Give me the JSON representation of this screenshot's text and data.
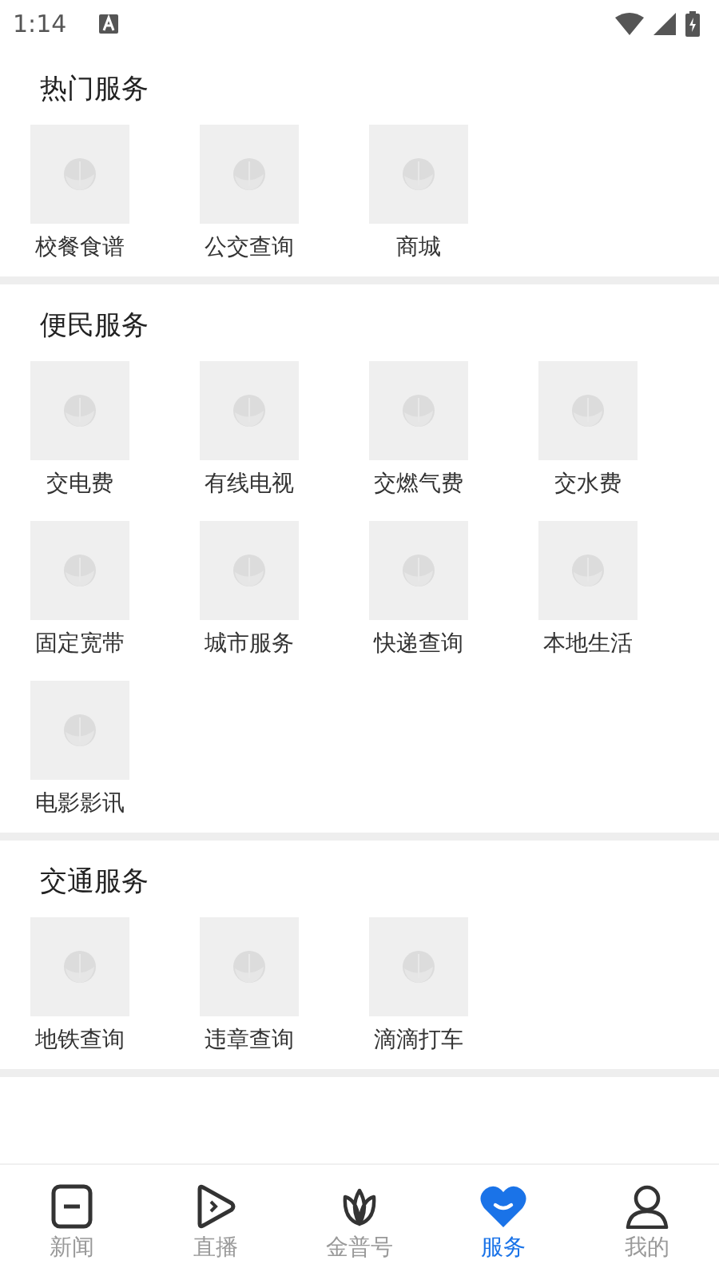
{
  "status_bar": {
    "time": "1:14"
  },
  "sections": [
    {
      "title": "热门服务",
      "items": [
        {
          "label": "校餐食谱"
        },
        {
          "label": "公交查询"
        },
        {
          "label": "商城"
        }
      ]
    },
    {
      "title": "便民服务",
      "items": [
        {
          "label": "交电费"
        },
        {
          "label": "有线电视"
        },
        {
          "label": "交燃气费"
        },
        {
          "label": "交水费"
        },
        {
          "label": "固定宽带"
        },
        {
          "label": "城市服务"
        },
        {
          "label": "快递查询"
        },
        {
          "label": "本地生活"
        },
        {
          "label": "电影影讯"
        }
      ]
    },
    {
      "title": "交通服务",
      "items": [
        {
          "label": "地铁查询"
        },
        {
          "label": "违章查询"
        },
        {
          "label": "滴滴打车"
        }
      ]
    }
  ],
  "bottom_nav": [
    {
      "label": "新闻",
      "selected": false
    },
    {
      "label": "直播",
      "selected": false
    },
    {
      "label": "金普号",
      "selected": false
    },
    {
      "label": "服务",
      "selected": true
    },
    {
      "label": "我的",
      "selected": false
    }
  ]
}
